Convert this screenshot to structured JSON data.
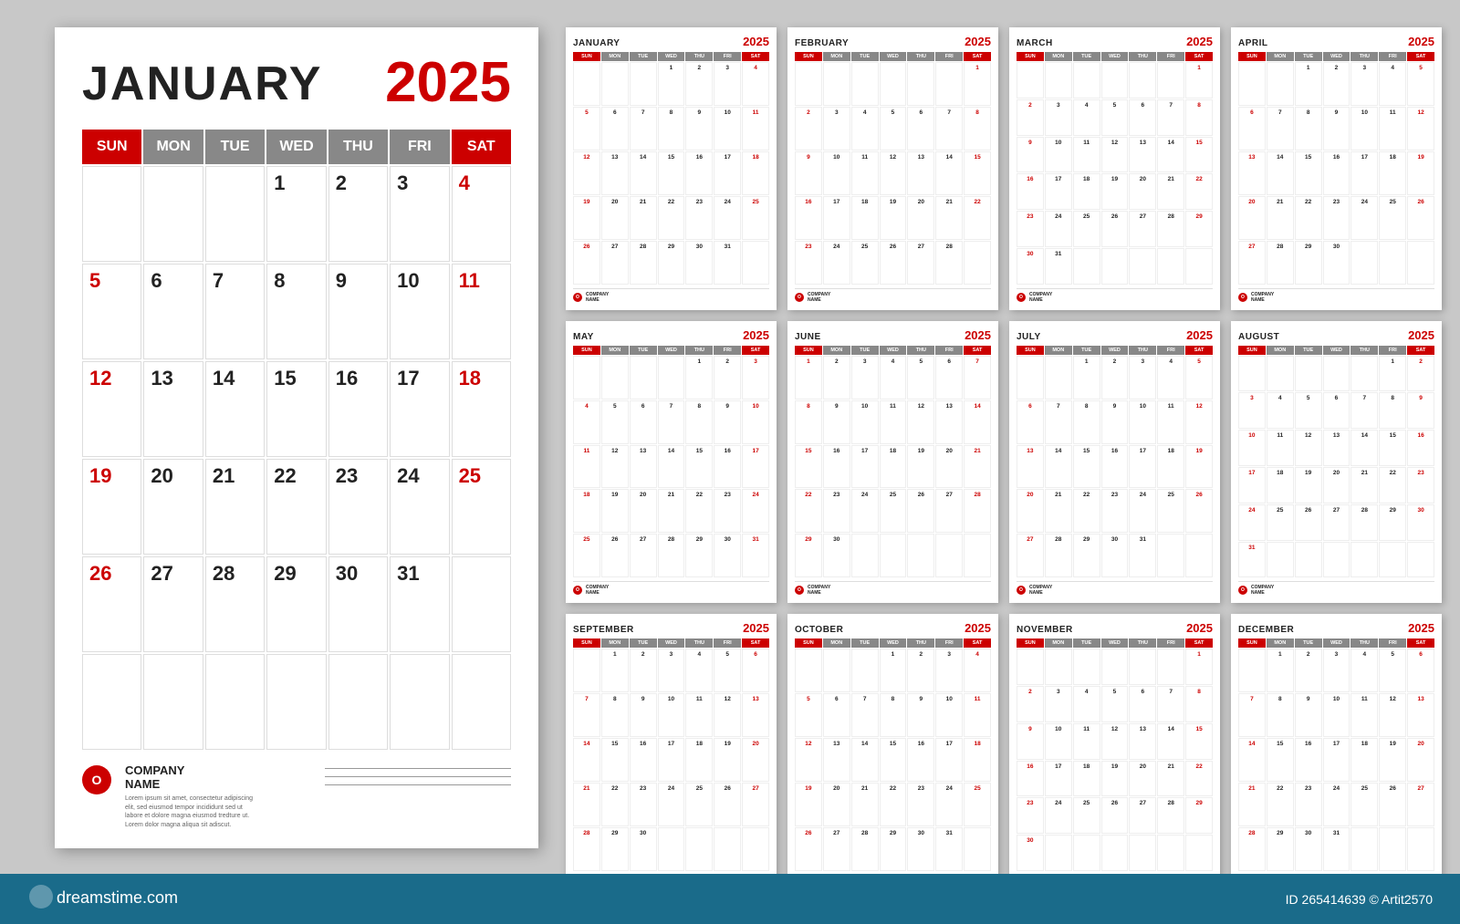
{
  "main_calendar": {
    "month": "JANUARY",
    "year": "2025",
    "days_headers": [
      "SUN",
      "MON",
      "TUE",
      "WED",
      "THU",
      "FRI",
      "SAT"
    ],
    "weeks": [
      [
        "",
        "",
        "",
        "1",
        "2",
        "3",
        "4"
      ],
      [
        "5",
        "6",
        "7",
        "8",
        "9",
        "10",
        "11"
      ],
      [
        "12",
        "13",
        "14",
        "15",
        "16",
        "17",
        "18"
      ],
      [
        "19",
        "20",
        "21",
        "22",
        "23",
        "24",
        "25"
      ],
      [
        "26",
        "27",
        "28",
        "29",
        "30",
        "31",
        ""
      ],
      [
        "",
        "",
        "",
        "",
        "",
        "",
        ""
      ]
    ],
    "sun_indices": [
      0
    ],
    "sat_indices": [
      6
    ],
    "company": {
      "name": "COMPANY\nNAME",
      "desc": "Lorem ipsum sit amet, consectetur\nadipiscing elit, sed eiusmod tempor\nincididunt sed ut labore et dolore magna\neiusmod tredture ut. Lorem dolor magna\naliqua sit adiscut."
    }
  },
  "small_calendars": [
    {
      "month": "JANUARY",
      "year": "2025",
      "weeks": [
        [
          "",
          "",
          "",
          "1",
          "2",
          "3",
          "4"
        ],
        [
          "5",
          "6",
          "7",
          "8",
          "9",
          "10",
          "11"
        ],
        [
          "12",
          "13",
          "14",
          "15",
          "16",
          "17",
          "18"
        ],
        [
          "19",
          "20",
          "21",
          "22",
          "23",
          "24",
          "25"
        ],
        [
          "26",
          "27",
          "28",
          "29",
          "30",
          "31",
          ""
        ]
      ]
    },
    {
      "month": "FEBRUARY",
      "year": "2025",
      "weeks": [
        [
          "",
          "",
          "",
          "",
          "",
          "",
          "1"
        ],
        [
          "2",
          "3",
          "4",
          "5",
          "6",
          "7",
          "8"
        ],
        [
          "9",
          "10",
          "11",
          "12",
          "13",
          "14",
          "15"
        ],
        [
          "16",
          "17",
          "18",
          "19",
          "20",
          "21",
          "22"
        ],
        [
          "23",
          "24",
          "25",
          "26",
          "27",
          "28",
          ""
        ]
      ]
    },
    {
      "month": "MARCH",
      "year": "2025",
      "weeks": [
        [
          "",
          "",
          "",
          "",
          "",
          "",
          "1"
        ],
        [
          "2",
          "3",
          "4",
          "5",
          "6",
          "7",
          "8"
        ],
        [
          "9",
          "10",
          "11",
          "12",
          "13",
          "14",
          "15"
        ],
        [
          "16",
          "17",
          "18",
          "19",
          "20",
          "21",
          "22"
        ],
        [
          "23",
          "24",
          "25",
          "26",
          "27",
          "28",
          "29"
        ],
        [
          "30",
          "31",
          "",
          "",
          "",
          "",
          ""
        ]
      ]
    },
    {
      "month": "APRIL",
      "year": "2025",
      "weeks": [
        [
          "",
          "",
          "1",
          "2",
          "3",
          "4",
          "5"
        ],
        [
          "6",
          "7",
          "8",
          "9",
          "10",
          "11",
          "12"
        ],
        [
          "13",
          "14",
          "15",
          "16",
          "17",
          "18",
          "19"
        ],
        [
          "20",
          "21",
          "22",
          "23",
          "24",
          "25",
          "26"
        ],
        [
          "27",
          "28",
          "29",
          "30",
          "",
          "",
          ""
        ]
      ]
    },
    {
      "month": "MAY",
      "year": "2025",
      "weeks": [
        [
          "",
          "",
          "",
          "",
          "1",
          "2",
          "3"
        ],
        [
          "4",
          "5",
          "6",
          "7",
          "8",
          "9",
          "10"
        ],
        [
          "11",
          "12",
          "13",
          "14",
          "15",
          "16",
          "17"
        ],
        [
          "18",
          "19",
          "20",
          "21",
          "22",
          "23",
          "24"
        ],
        [
          "25",
          "26",
          "27",
          "28",
          "29",
          "30",
          "31"
        ]
      ]
    },
    {
      "month": "JUNE",
      "year": "2025",
      "weeks": [
        [
          "1",
          "2",
          "3",
          "4",
          "5",
          "6",
          "7"
        ],
        [
          "8",
          "9",
          "10",
          "11",
          "12",
          "13",
          "14"
        ],
        [
          "15",
          "16",
          "17",
          "18",
          "19",
          "20",
          "21"
        ],
        [
          "22",
          "23",
          "24",
          "25",
          "26",
          "27",
          "28"
        ],
        [
          "29",
          "30",
          "",
          "",
          "",
          "",
          ""
        ]
      ]
    },
    {
      "month": "JULY",
      "year": "2025",
      "weeks": [
        [
          "",
          "",
          "1",
          "2",
          "3",
          "4",
          "5"
        ],
        [
          "6",
          "7",
          "8",
          "9",
          "10",
          "11",
          "12"
        ],
        [
          "13",
          "14",
          "15",
          "16",
          "17",
          "18",
          "19"
        ],
        [
          "20",
          "21",
          "22",
          "23",
          "24",
          "25",
          "26"
        ],
        [
          "27",
          "28",
          "29",
          "30",
          "31",
          "",
          ""
        ]
      ]
    },
    {
      "month": "AUGUST",
      "year": "2025",
      "weeks": [
        [
          "",
          "",
          "",
          "",
          "",
          "1",
          "2"
        ],
        [
          "3",
          "4",
          "5",
          "6",
          "7",
          "8",
          "9"
        ],
        [
          "10",
          "11",
          "12",
          "13",
          "14",
          "15",
          "16"
        ],
        [
          "17",
          "18",
          "19",
          "20",
          "21",
          "22",
          "23"
        ],
        [
          "24",
          "25",
          "26",
          "27",
          "28",
          "29",
          "30"
        ],
        [
          "31",
          "",
          "",
          "",
          "",
          "",
          ""
        ]
      ]
    },
    {
      "month": "SEPTEMBER",
      "year": "2025",
      "weeks": [
        [
          "",
          "1",
          "2",
          "3",
          "4",
          "5",
          "6"
        ],
        [
          "7",
          "8",
          "9",
          "10",
          "11",
          "12",
          "13"
        ],
        [
          "14",
          "15",
          "16",
          "17",
          "18",
          "19",
          "20"
        ],
        [
          "21",
          "22",
          "23",
          "24",
          "25",
          "26",
          "27"
        ],
        [
          "28",
          "29",
          "30",
          "",
          "",
          "",
          ""
        ]
      ]
    },
    {
      "month": "OCTOBER",
      "year": "2025",
      "weeks": [
        [
          "",
          "",
          "",
          "1",
          "2",
          "3",
          "4"
        ],
        [
          "5",
          "6",
          "7",
          "8",
          "9",
          "10",
          "11"
        ],
        [
          "12",
          "13",
          "14",
          "15",
          "16",
          "17",
          "18"
        ],
        [
          "19",
          "20",
          "21",
          "22",
          "23",
          "24",
          "25"
        ],
        [
          "26",
          "27",
          "28",
          "29",
          "30",
          "31",
          ""
        ]
      ]
    },
    {
      "month": "NOVEMBER",
      "year": "2025",
      "weeks": [
        [
          "",
          "",
          "",
          "",
          "",
          "",
          "1"
        ],
        [
          "2",
          "3",
          "4",
          "5",
          "6",
          "7",
          "8"
        ],
        [
          "9",
          "10",
          "11",
          "12",
          "13",
          "14",
          "15"
        ],
        [
          "16",
          "17",
          "18",
          "19",
          "20",
          "21",
          "22"
        ],
        [
          "23",
          "24",
          "25",
          "26",
          "27",
          "28",
          "29"
        ],
        [
          "30",
          "",
          "",
          "",
          "",
          "",
          ""
        ]
      ]
    },
    {
      "month": "DECEMBER",
      "year": "2025",
      "weeks": [
        [
          "",
          "1",
          "2",
          "3",
          "4",
          "5",
          "6"
        ],
        [
          "7",
          "8",
          "9",
          "10",
          "11",
          "12",
          "13"
        ],
        [
          "14",
          "15",
          "16",
          "17",
          "18",
          "19",
          "20"
        ],
        [
          "21",
          "22",
          "23",
          "24",
          "25",
          "26",
          "27"
        ],
        [
          "28",
          "29",
          "30",
          "31",
          "",
          "",
          ""
        ]
      ]
    }
  ],
  "footer": {
    "dreamstime_text": "dreamstime.com",
    "image_id": "ID 265414639 © Artit2570"
  },
  "days_abbr": [
    "SUN",
    "MON",
    "TUE",
    "WED",
    "THU",
    "FRI",
    "SAT"
  ],
  "company_label": "COMPANY\nNAME"
}
